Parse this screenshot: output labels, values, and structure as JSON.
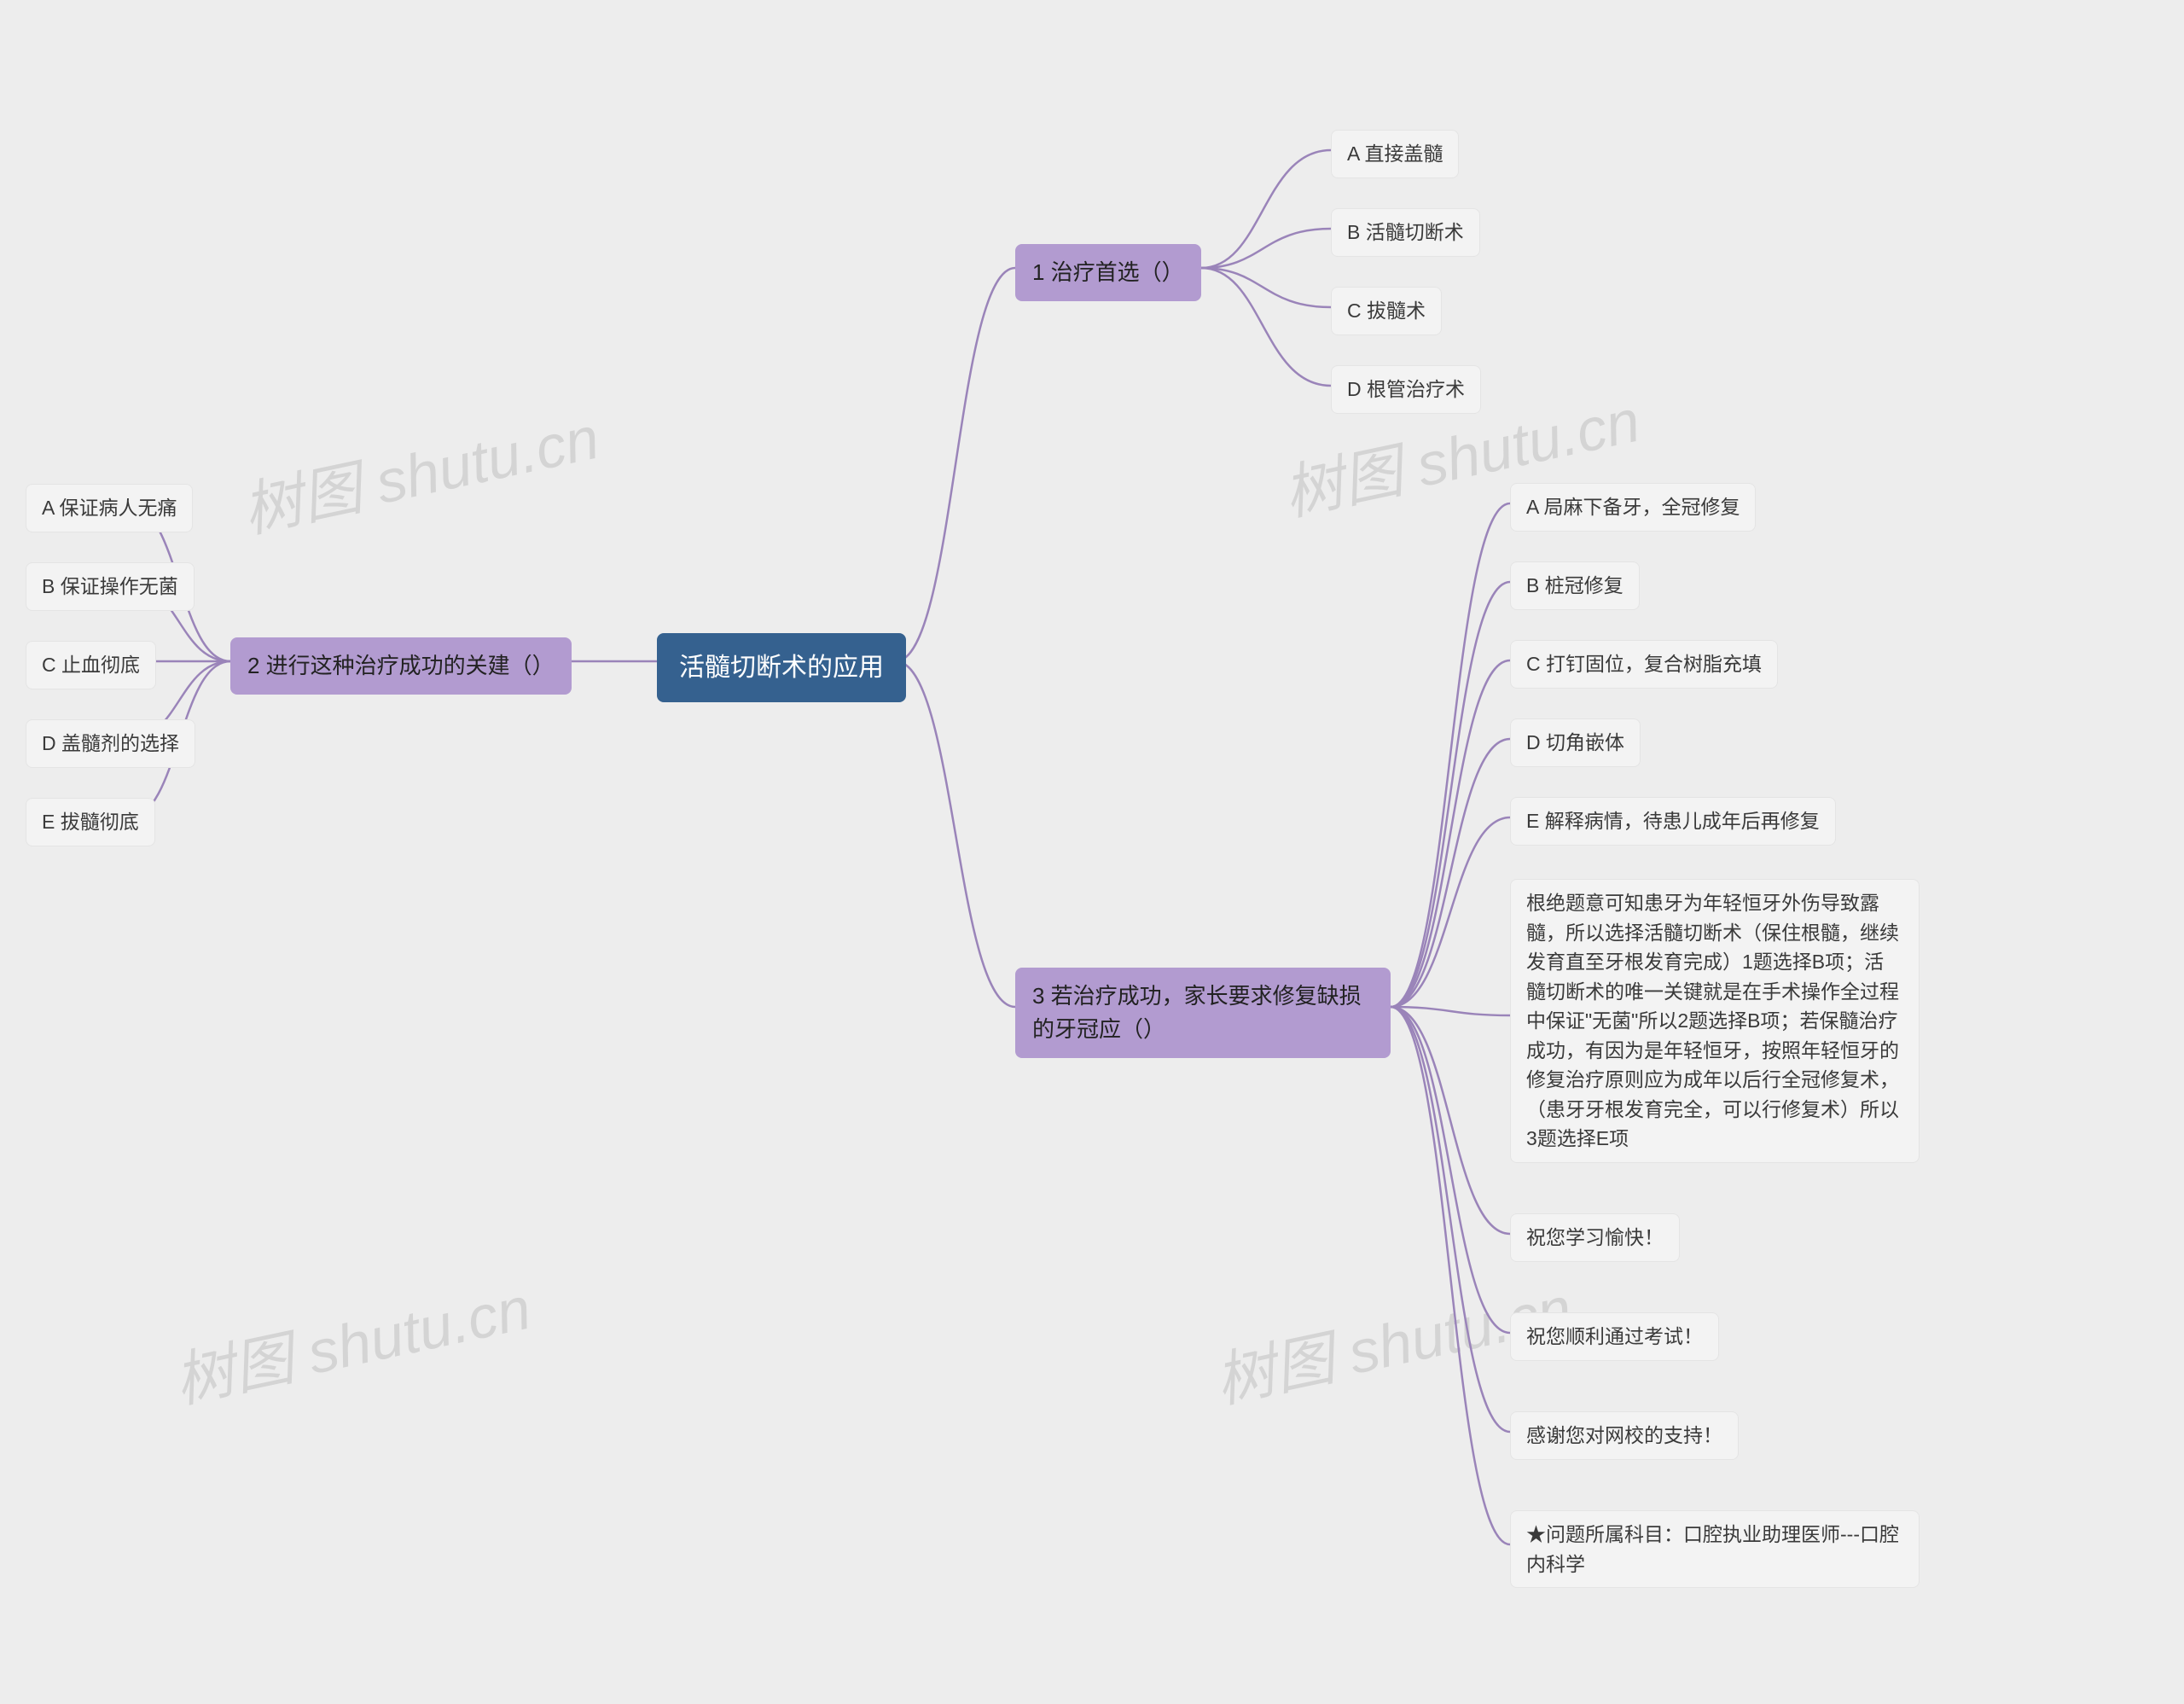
{
  "watermark": "树图 shutu.cn",
  "root": {
    "title": "活髓切断术的应用"
  },
  "branches": {
    "b1": {
      "label": "1 治疗首选（）",
      "leaves": [
        "A 直接盖髓",
        "B 活髓切断术",
        "C 拔髓术",
        "D 根管治疗术"
      ]
    },
    "b2": {
      "label": "2 进行这种治疗成功的关建（）",
      "leaves": [
        "A 保证病人无痛",
        "B 保证操作无菌",
        "C 止血彻底",
        "D 盖髓剂的选择",
        "E 拔髓彻底"
      ]
    },
    "b3": {
      "label": "3 若治疗成功，家长要求修复缺损的牙冠应（）",
      "leaves": [
        "A 局麻下备牙，全冠修复",
        "B 桩冠修复",
        "C 打钉固位，复合树脂充填",
        "D 切角嵌体",
        "E 解释病情，待患儿成年后再修复",
        "根绝题意可知患牙为年轻恒牙外伤导致露髓，所以选择活髓切断术（保住根髓，继续发育直至牙根发育完成）1题选择B项；活髓切断术的唯一关键就是在手术操作全过程中保证\"无菌\"所以2题选择B项；若保髓治疗成功，有因为是年轻恒牙，按照年轻恒牙的修复治疗原则应为成年以后行全冠修复术，（患牙牙根发育完全，可以行修复术）所以3题选择E项",
        "祝您学习愉快！",
        "祝您顺利通过考试！",
        "感谢您对网校的支持！",
        "★问题所属科目：口腔执业助理医师---口腔内科学"
      ]
    }
  }
}
